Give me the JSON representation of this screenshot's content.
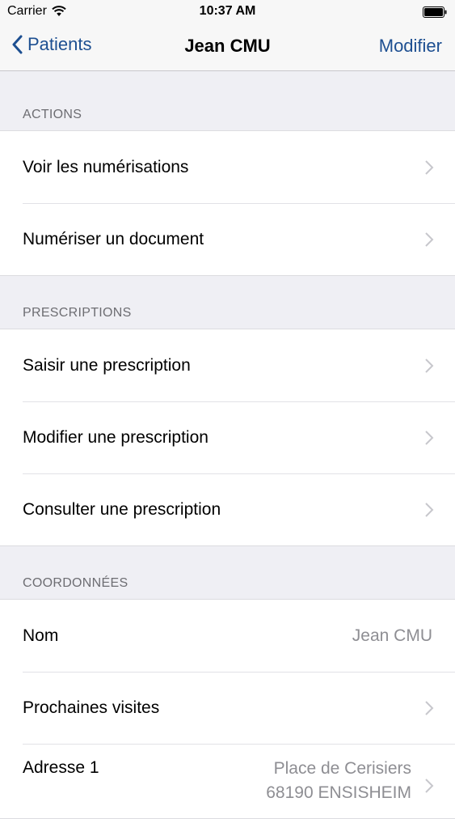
{
  "status_bar": {
    "carrier": "Carrier",
    "time": "10:37 AM"
  },
  "nav": {
    "back_label": "Patients",
    "title": "Jean CMU",
    "action_label": "Modifier"
  },
  "sections": {
    "actions": {
      "header": "ACTIONS",
      "rows": [
        "Voir les numérisations",
        "Numériser un document"
      ]
    },
    "prescriptions": {
      "header": "PRESCRIPTIONS",
      "rows": [
        "Saisir une prescription",
        "Modifier une prescription",
        "Consulter une prescription"
      ]
    },
    "coordonnees": {
      "header": "COORDONNÉES",
      "nom": {
        "label": "Nom",
        "value": "Jean CMU"
      },
      "visites": {
        "label": "Prochaines visites"
      },
      "adresse": {
        "label": "Adresse 1",
        "line1": "Place de Cerisiers",
        "line2": "68190 ENSISHEIM"
      }
    }
  },
  "colors": {
    "accent": "#1d4f91",
    "background": "#efeff4",
    "secondary_text": "#8e8e93"
  },
  "icons": [
    "wifi-icon",
    "battery-icon",
    "back-chevron-icon",
    "chevron-right-icon"
  ]
}
